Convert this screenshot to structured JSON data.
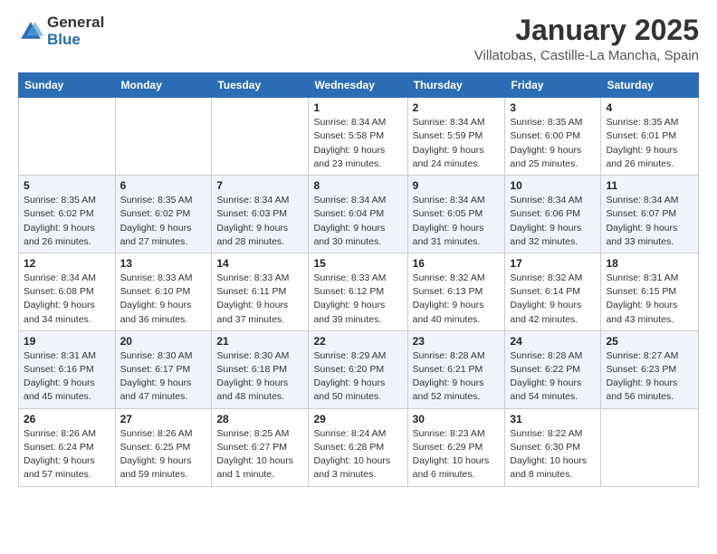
{
  "logo": {
    "general": "General",
    "blue": "Blue"
  },
  "header": {
    "month": "January 2025",
    "location": "Villatobas, Castille-La Mancha, Spain"
  },
  "weekdays": [
    "Sunday",
    "Monday",
    "Tuesday",
    "Wednesday",
    "Thursday",
    "Friday",
    "Saturday"
  ],
  "weeks": [
    [
      {
        "day": "",
        "info": ""
      },
      {
        "day": "",
        "info": ""
      },
      {
        "day": "",
        "info": ""
      },
      {
        "day": "1",
        "info": "Sunrise: 8:34 AM\nSunset: 5:58 PM\nDaylight: 9 hours\nand 23 minutes."
      },
      {
        "day": "2",
        "info": "Sunrise: 8:34 AM\nSunset: 5:59 PM\nDaylight: 9 hours\nand 24 minutes."
      },
      {
        "day": "3",
        "info": "Sunrise: 8:35 AM\nSunset: 6:00 PM\nDaylight: 9 hours\nand 25 minutes."
      },
      {
        "day": "4",
        "info": "Sunrise: 8:35 AM\nSunset: 6:01 PM\nDaylight: 9 hours\nand 26 minutes."
      }
    ],
    [
      {
        "day": "5",
        "info": "Sunrise: 8:35 AM\nSunset: 6:02 PM\nDaylight: 9 hours\nand 26 minutes."
      },
      {
        "day": "6",
        "info": "Sunrise: 8:35 AM\nSunset: 6:02 PM\nDaylight: 9 hours\nand 27 minutes."
      },
      {
        "day": "7",
        "info": "Sunrise: 8:34 AM\nSunset: 6:03 PM\nDaylight: 9 hours\nand 28 minutes."
      },
      {
        "day": "8",
        "info": "Sunrise: 8:34 AM\nSunset: 6:04 PM\nDaylight: 9 hours\nand 30 minutes."
      },
      {
        "day": "9",
        "info": "Sunrise: 8:34 AM\nSunset: 6:05 PM\nDaylight: 9 hours\nand 31 minutes."
      },
      {
        "day": "10",
        "info": "Sunrise: 8:34 AM\nSunset: 6:06 PM\nDaylight: 9 hours\nand 32 minutes."
      },
      {
        "day": "11",
        "info": "Sunrise: 8:34 AM\nSunset: 6:07 PM\nDaylight: 9 hours\nand 33 minutes."
      }
    ],
    [
      {
        "day": "12",
        "info": "Sunrise: 8:34 AM\nSunset: 6:08 PM\nDaylight: 9 hours\nand 34 minutes."
      },
      {
        "day": "13",
        "info": "Sunrise: 8:33 AM\nSunset: 6:10 PM\nDaylight: 9 hours\nand 36 minutes."
      },
      {
        "day": "14",
        "info": "Sunrise: 8:33 AM\nSunset: 6:11 PM\nDaylight: 9 hours\nand 37 minutes."
      },
      {
        "day": "15",
        "info": "Sunrise: 8:33 AM\nSunset: 6:12 PM\nDaylight: 9 hours\nand 39 minutes."
      },
      {
        "day": "16",
        "info": "Sunrise: 8:32 AM\nSunset: 6:13 PM\nDaylight: 9 hours\nand 40 minutes."
      },
      {
        "day": "17",
        "info": "Sunrise: 8:32 AM\nSunset: 6:14 PM\nDaylight: 9 hours\nand 42 minutes."
      },
      {
        "day": "18",
        "info": "Sunrise: 8:31 AM\nSunset: 6:15 PM\nDaylight: 9 hours\nand 43 minutes."
      }
    ],
    [
      {
        "day": "19",
        "info": "Sunrise: 8:31 AM\nSunset: 6:16 PM\nDaylight: 9 hours\nand 45 minutes."
      },
      {
        "day": "20",
        "info": "Sunrise: 8:30 AM\nSunset: 6:17 PM\nDaylight: 9 hours\nand 47 minutes."
      },
      {
        "day": "21",
        "info": "Sunrise: 8:30 AM\nSunset: 6:18 PM\nDaylight: 9 hours\nand 48 minutes."
      },
      {
        "day": "22",
        "info": "Sunrise: 8:29 AM\nSunset: 6:20 PM\nDaylight: 9 hours\nand 50 minutes."
      },
      {
        "day": "23",
        "info": "Sunrise: 8:28 AM\nSunset: 6:21 PM\nDaylight: 9 hours\nand 52 minutes."
      },
      {
        "day": "24",
        "info": "Sunrise: 8:28 AM\nSunset: 6:22 PM\nDaylight: 9 hours\nand 54 minutes."
      },
      {
        "day": "25",
        "info": "Sunrise: 8:27 AM\nSunset: 6:23 PM\nDaylight: 9 hours\nand 56 minutes."
      }
    ],
    [
      {
        "day": "26",
        "info": "Sunrise: 8:26 AM\nSunset: 6:24 PM\nDaylight: 9 hours\nand 57 minutes."
      },
      {
        "day": "27",
        "info": "Sunrise: 8:26 AM\nSunset: 6:25 PM\nDaylight: 9 hours\nand 59 minutes."
      },
      {
        "day": "28",
        "info": "Sunrise: 8:25 AM\nSunset: 6:27 PM\nDaylight: 10 hours\nand 1 minute."
      },
      {
        "day": "29",
        "info": "Sunrise: 8:24 AM\nSunset: 6:28 PM\nDaylight: 10 hours\nand 3 minutes."
      },
      {
        "day": "30",
        "info": "Sunrise: 8:23 AM\nSunset: 6:29 PM\nDaylight: 10 hours\nand 6 minutes."
      },
      {
        "day": "31",
        "info": "Sunrise: 8:22 AM\nSunset: 6:30 PM\nDaylight: 10 hours\nand 8 minutes."
      },
      {
        "day": "",
        "info": ""
      }
    ]
  ]
}
